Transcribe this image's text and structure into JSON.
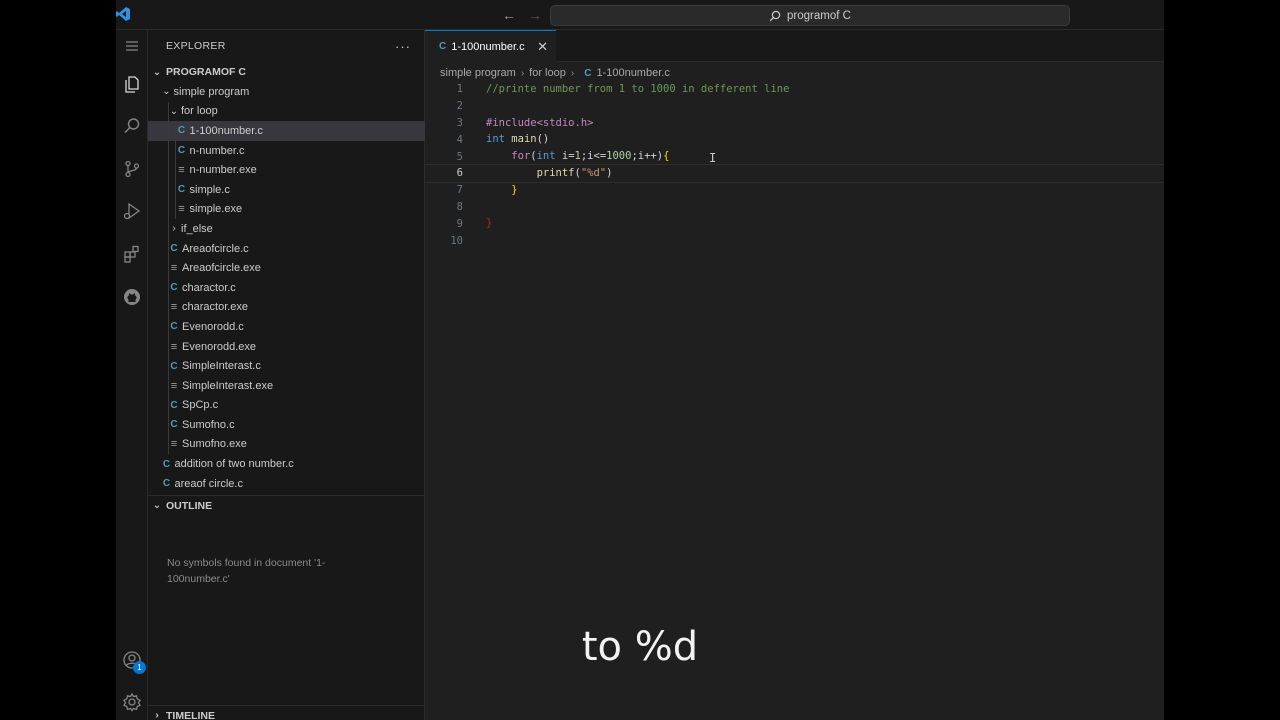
{
  "titlebar": {
    "search_label": "programof C",
    "back": "←",
    "forward": "→"
  },
  "activity": {
    "account_badge": "1"
  },
  "explorer": {
    "header": "EXPLORER",
    "more": "···",
    "root": "PROGRAMOF C",
    "items": [
      {
        "label": "simple program",
        "type": "folder",
        "depth": 1,
        "open": true
      },
      {
        "label": "for loop",
        "type": "folder",
        "depth": 2,
        "open": true
      },
      {
        "label": "1-100number.c",
        "type": "c",
        "depth": 3,
        "selected": true
      },
      {
        "label": "n-number.c",
        "type": "c",
        "depth": 3
      },
      {
        "label": "n-number.exe",
        "type": "exe",
        "depth": 3
      },
      {
        "label": "simple.c",
        "type": "c",
        "depth": 3
      },
      {
        "label": "simple.exe",
        "type": "exe",
        "depth": 3
      },
      {
        "label": "if_else",
        "type": "folder",
        "depth": 2,
        "open": false
      },
      {
        "label": "Areaofcircle.c",
        "type": "c",
        "depth": 2
      },
      {
        "label": "Areaofcircle.exe",
        "type": "exe",
        "depth": 2
      },
      {
        "label": "charactor.c",
        "type": "c",
        "depth": 2
      },
      {
        "label": "charactor.exe",
        "type": "exe",
        "depth": 2
      },
      {
        "label": "Evenorodd.c",
        "type": "c",
        "depth": 2
      },
      {
        "label": "Evenorodd.exe",
        "type": "exe",
        "depth": 2
      },
      {
        "label": "SimpleInterast.c",
        "type": "c",
        "depth": 2
      },
      {
        "label": "SimpleInterast.exe",
        "type": "exe",
        "depth": 2
      },
      {
        "label": "SpCp.c",
        "type": "c",
        "depth": 2
      },
      {
        "label": "Sumofno.c",
        "type": "c",
        "depth": 2
      },
      {
        "label": "Sumofno.exe",
        "type": "exe",
        "depth": 2
      },
      {
        "label": "addition of two number.c",
        "type": "c",
        "depth": 1
      },
      {
        "label": "areaof circle.c",
        "type": "c",
        "depth": 1
      }
    ],
    "outline_header": "OUTLINE",
    "outline_message": "No symbols found in document '1-100number.c'",
    "timeline_header": "TIMELINE"
  },
  "editor": {
    "tab_label": "1-100number.c",
    "tab_close": "✕",
    "breadcrumb": [
      "simple program",
      "for loop",
      "1-100number.c"
    ],
    "active_line": 6,
    "lines": [
      "//printe number from 1 to 1000 in defferent line",
      "",
      "#include<stdio.h>",
      "int main()",
      "    for(int i=1;i<=1000;i++){",
      "        printf(\"%d\")",
      "    }",
      "",
      "}",
      ""
    ]
  },
  "caption": "to %d"
}
